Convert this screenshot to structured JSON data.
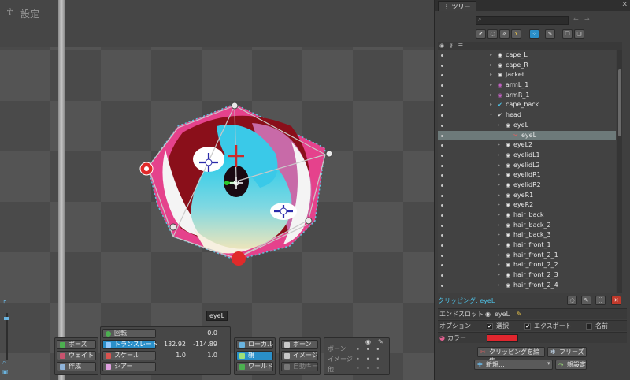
{
  "viewport": {
    "title": "設定",
    "tooltip": "eyeL"
  },
  "toolbar": {
    "mode_buttons": [
      "ポーズ",
      "ウェイト",
      "作成"
    ],
    "transform": {
      "rotate": {
        "label": "回転",
        "value": "0.0"
      },
      "translate": {
        "label": "トランスレート",
        "x": "132.92",
        "y": "-114.89"
      },
      "scale": {
        "label": "スケール",
        "x": "1.0",
        "y": "1.0"
      },
      "shear": {
        "label": "シアー",
        "value": ""
      }
    },
    "axis_buttons": [
      "ローカル",
      "親",
      "ワールド"
    ],
    "bone_buttons": [
      "ボーン",
      "イメージ",
      "自動キー"
    ],
    "key_labels": [
      "ボーン",
      "イメージ",
      "他"
    ]
  },
  "tree": {
    "tab": "ツリー",
    "search_placeholder": "",
    "items": [
      {
        "label": "cape_L",
        "depth": 1,
        "icon": "bone-icon",
        "color": "#e8e8e8"
      },
      {
        "label": "cape_R",
        "depth": 1,
        "icon": "bone-icon",
        "color": "#e8e8e8"
      },
      {
        "label": "jacket",
        "depth": 1,
        "icon": "bone-icon",
        "color": "#e8e8e8"
      },
      {
        "label": "armL_1",
        "depth": 1,
        "icon": "bone-icon",
        "color": "#c060c0"
      },
      {
        "label": "armR_1",
        "depth": 1,
        "icon": "bone-icon",
        "color": "#c060c0"
      },
      {
        "label": "cape_back",
        "depth": 1,
        "icon": "check-icon",
        "color": "#4fc3e8"
      },
      {
        "label": "head",
        "depth": 1,
        "icon": "check-icon",
        "color": "#e8e8e8"
      },
      {
        "label": "eyeL",
        "depth": 2,
        "icon": "bone-icon",
        "color": "#e8e8e8"
      },
      {
        "label": "eyeL",
        "depth": 3,
        "icon": "clipping-icon",
        "color": "#e06060",
        "selected": true
      },
      {
        "label": "eyeL2",
        "depth": 2,
        "icon": "bone-icon",
        "color": "#e8e8e8"
      },
      {
        "label": "eyelidL1",
        "depth": 2,
        "icon": "bone-icon",
        "color": "#e8e8e8"
      },
      {
        "label": "eyelidL2",
        "depth": 2,
        "icon": "bone-icon",
        "color": "#e8e8e8"
      },
      {
        "label": "eyelidR1",
        "depth": 2,
        "icon": "bone-icon",
        "color": "#e8e8e8"
      },
      {
        "label": "eyelidR2",
        "depth": 2,
        "icon": "bone-icon",
        "color": "#e8e8e8"
      },
      {
        "label": "eyeR1",
        "depth": 2,
        "icon": "bone-icon",
        "color": "#e8e8e8"
      },
      {
        "label": "eyeR2",
        "depth": 2,
        "icon": "bone-icon",
        "color": "#e8e8e8"
      },
      {
        "label": "hair_back",
        "depth": 2,
        "icon": "bone-icon",
        "color": "#e8e8e8"
      },
      {
        "label": "hair_back_2",
        "depth": 2,
        "icon": "bone-icon",
        "color": "#e8e8e8"
      },
      {
        "label": "hair_back_3",
        "depth": 2,
        "icon": "bone-icon",
        "color": "#e8e8e8"
      },
      {
        "label": "hair_front_1",
        "depth": 2,
        "icon": "bone-icon",
        "color": "#e8e8e8"
      },
      {
        "label": "hair_front_2_1",
        "depth": 2,
        "icon": "bone-icon",
        "color": "#e8e8e8"
      },
      {
        "label": "hair_front_2_2",
        "depth": 2,
        "icon": "bone-icon",
        "color": "#e8e8e8"
      },
      {
        "label": "hair_front_2_3",
        "depth": 2,
        "icon": "bone-icon",
        "color": "#e8e8e8"
      },
      {
        "label": "hair_front_2_4",
        "depth": 2,
        "icon": "bone-icon",
        "color": "#e8e8e8"
      }
    ],
    "clipping_label": "クリッピング: eyeL",
    "props": {
      "end_slot_label": "エンドスロット",
      "end_slot_value": "eyeL",
      "options_label": "オプション",
      "select_label": "選択",
      "export_label": "エクスポート",
      "name_label": "名前",
      "color_label": "カラー",
      "color_value": "#e0262e"
    },
    "buttons": {
      "edit_clipping": "クリッピングを編集",
      "freeze": "フリーズ",
      "new": "新規...",
      "parent": "親設定"
    }
  }
}
